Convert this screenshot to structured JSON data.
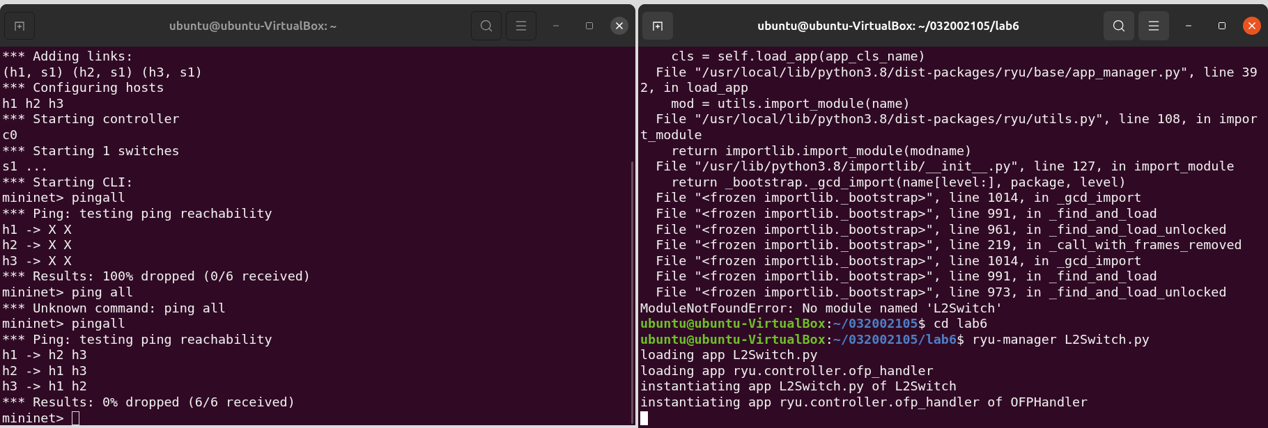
{
  "windows": [
    {
      "title": "ubuntu@ubuntu-VirtualBox: ~",
      "focused": false,
      "lines": [
        {
          "kind": "text",
          "text": "*** Adding links:"
        },
        {
          "kind": "text",
          "text": "(h1, s1) (h2, s1) (h3, s1)"
        },
        {
          "kind": "text",
          "text": "*** Configuring hosts"
        },
        {
          "kind": "text",
          "text": "h1 h2 h3"
        },
        {
          "kind": "text",
          "text": "*** Starting controller"
        },
        {
          "kind": "text",
          "text": "c0"
        },
        {
          "kind": "text",
          "text": "*** Starting 1 switches"
        },
        {
          "kind": "text",
          "text": "s1 ..."
        },
        {
          "kind": "text",
          "text": "*** Starting CLI:"
        },
        {
          "kind": "text",
          "text": "mininet> pingall"
        },
        {
          "kind": "text",
          "text": "*** Ping: testing ping reachability"
        },
        {
          "kind": "text",
          "text": "h1 -> X X"
        },
        {
          "kind": "text",
          "text": "h2 -> X X"
        },
        {
          "kind": "text",
          "text": "h3 -> X X"
        },
        {
          "kind": "text",
          "text": "*** Results: 100% dropped (0/6 received)"
        },
        {
          "kind": "text",
          "text": "mininet> ping all"
        },
        {
          "kind": "text",
          "text": "*** Unknown command: ping all"
        },
        {
          "kind": "text",
          "text": "mininet> pingall"
        },
        {
          "kind": "text",
          "text": "*** Ping: testing ping reachability"
        },
        {
          "kind": "text",
          "text": "h1 -> h2 h3"
        },
        {
          "kind": "text",
          "text": "h2 -> h1 h3"
        },
        {
          "kind": "text",
          "text": "h3 -> h1 h2"
        },
        {
          "kind": "text",
          "text": "*** Results: 0% dropped (6/6 received)"
        },
        {
          "kind": "input",
          "text": "mininet>"
        }
      ]
    },
    {
      "title": "ubuntu@ubuntu-VirtualBox: ~/032002105/lab6",
      "focused": true,
      "lines": [
        {
          "kind": "text",
          "text": "    cls = self.load_app(app_cls_name)"
        },
        {
          "kind": "text",
          "text": "  File \"/usr/local/lib/python3.8/dist-packages/ryu/base/app_manager.py\", line 39"
        },
        {
          "kind": "text",
          "text": "2, in load_app"
        },
        {
          "kind": "text",
          "text": "    mod = utils.import_module(name)"
        },
        {
          "kind": "text",
          "text": "  File \"/usr/local/lib/python3.8/dist-packages/ryu/utils.py\", line 108, in impor"
        },
        {
          "kind": "text",
          "text": "t_module"
        },
        {
          "kind": "text",
          "text": "    return importlib.import_module(modname)"
        },
        {
          "kind": "text",
          "text": "  File \"/usr/lib/python3.8/importlib/__init__.py\", line 127, in import_module"
        },
        {
          "kind": "text",
          "text": "    return _bootstrap._gcd_import(name[level:], package, level)"
        },
        {
          "kind": "text",
          "text": "  File \"<frozen importlib._bootstrap>\", line 1014, in _gcd_import"
        },
        {
          "kind": "text",
          "text": "  File \"<frozen importlib._bootstrap>\", line 991, in _find_and_load"
        },
        {
          "kind": "text",
          "text": "  File \"<frozen importlib._bootstrap>\", line 961, in _find_and_load_unlocked"
        },
        {
          "kind": "text",
          "text": "  File \"<frozen importlib._bootstrap>\", line 219, in _call_with_frames_removed"
        },
        {
          "kind": "text",
          "text": "  File \"<frozen importlib._bootstrap>\", line 1014, in _gcd_import"
        },
        {
          "kind": "text",
          "text": "  File \"<frozen importlib._bootstrap>\", line 991, in _find_and_load"
        },
        {
          "kind": "text",
          "text": "  File \"<frozen importlib._bootstrap>\", line 973, in _find_and_load_unlocked"
        },
        {
          "kind": "text",
          "text": "ModuleNotFoundError: No module named 'L2Switch'"
        },
        {
          "kind": "prompt",
          "user": "ubuntu@ubuntu-VirtualBox",
          "separator": ":",
          "path": "~/032002105",
          "command": "$ cd lab6"
        },
        {
          "kind": "prompt",
          "user": "ubuntu@ubuntu-VirtualBox",
          "separator": ":",
          "path": "~/032002105/lab6",
          "command": "$ ryu-manager L2Switch.py"
        },
        {
          "kind": "text",
          "text": "loading app L2Switch.py"
        },
        {
          "kind": "text",
          "text": "loading app ryu.controller.ofp_handler"
        },
        {
          "kind": "text",
          "text": "instantiating app L2Switch.py of L2Switch"
        },
        {
          "kind": "text",
          "text": "instantiating app ryu.controller.ofp_handler of OFPHandler"
        },
        {
          "kind": "cursor"
        }
      ]
    }
  ]
}
